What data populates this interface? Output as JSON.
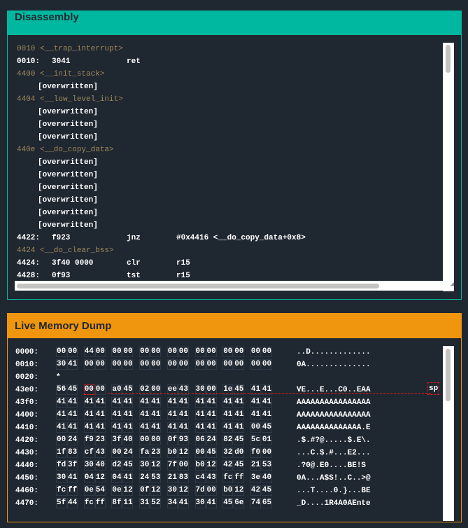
{
  "disassembly": {
    "title": "Disassembly",
    "lines": [
      {
        "kind": "label",
        "text": "0010 <__trap_interrupt>"
      },
      {
        "kind": "insn",
        "addr": "0010:",
        "bytes": "3041",
        "op": "ret",
        "args": ""
      },
      {
        "kind": "label",
        "text": "4400 <__init_stack>"
      },
      {
        "kind": "over",
        "text": "[overwritten]"
      },
      {
        "kind": "label",
        "text": "4404 <__low_level_init>"
      },
      {
        "kind": "over",
        "text": "[overwritten]"
      },
      {
        "kind": "over",
        "text": "[overwritten]"
      },
      {
        "kind": "over",
        "text": "[overwritten]"
      },
      {
        "kind": "label",
        "text": "440e <__do_copy_data>"
      },
      {
        "kind": "over",
        "text": "[overwritten]"
      },
      {
        "kind": "over",
        "text": "[overwritten]"
      },
      {
        "kind": "over",
        "text": "[overwritten]"
      },
      {
        "kind": "over",
        "text": "[overwritten]"
      },
      {
        "kind": "over",
        "text": "[overwritten]"
      },
      {
        "kind": "over",
        "text": "[overwritten]"
      },
      {
        "kind": "insn",
        "addr": "4422:",
        "bytes": "f923",
        "op": "jnz",
        "args": "#0x4416 <__do_copy_data+0x8>"
      },
      {
        "kind": "label",
        "text": "4424 <__do_clear_bss>"
      },
      {
        "kind": "insn",
        "addr": "4424:",
        "bytes": "3f40 0000",
        "op": "clr",
        "args": "r15"
      },
      {
        "kind": "insn",
        "addr": "4428:",
        "bytes": "0f93",
        "op": "tst",
        "args": "r15"
      }
    ]
  },
  "memory": {
    "title": "Live Memory Dump",
    "sp_label": "sp",
    "selected_byte": {
      "row": 3,
      "index": 2
    },
    "accent": "#e01b1b",
    "rows": [
      {
        "addr": "0000:",
        "words": [
          "0000",
          "4400",
          "0000",
          "0000",
          "0000",
          "0000",
          "0000",
          "0000"
        ],
        "ascii": "..D............."
      },
      {
        "addr": "0010:",
        "words": [
          "3041",
          "0000",
          "0000",
          "0000",
          "0000",
          "0000",
          "0000",
          "0000"
        ],
        "ascii": "0A.............."
      },
      {
        "addr": "0020:",
        "star": "*"
      },
      {
        "addr": "43e0:",
        "words": [
          "5645",
          "0000",
          "a045",
          "0200",
          "ee43",
          "3000",
          "1e45",
          "4141"
        ],
        "ascii": "VE...E...C0..EAA"
      },
      {
        "addr": "43f0:",
        "words": [
          "4141",
          "4141",
          "4141",
          "4141",
          "4141",
          "4141",
          "4141",
          "4141"
        ],
        "ascii": "AAAAAAAAAAAAAAAA"
      },
      {
        "addr": "4400:",
        "words": [
          "4141",
          "4141",
          "4141",
          "4141",
          "4141",
          "4141",
          "4141",
          "4141"
        ],
        "ascii": "AAAAAAAAAAAAAAAA"
      },
      {
        "addr": "4410:",
        "words": [
          "4141",
          "4141",
          "4141",
          "4141",
          "4141",
          "4141",
          "4141",
          "0045"
        ],
        "ascii": "AAAAAAAAAAAAAA.E"
      },
      {
        "addr": "4420:",
        "words": [
          "0024",
          "f923",
          "3f40",
          "0000",
          "0f93",
          "0624",
          "8245",
          "5c01"
        ],
        "ascii": ".$.#?@.....$.E\\."
      },
      {
        "addr": "4430:",
        "words": [
          "1f83",
          "cf43",
          "0024",
          "fa23",
          "b012",
          "0045",
          "32d0",
          "f000"
        ],
        "ascii": "...C.$.#...E2..."
      },
      {
        "addr": "4440:",
        "words": [
          "fd3f",
          "3040",
          "d245",
          "3012",
          "7f00",
          "b012",
          "4245",
          "2153"
        ],
        "ascii": ".?0@.E0....BE!S"
      },
      {
        "addr": "4450:",
        "words": [
          "3041",
          "0412",
          "0441",
          "2453",
          "2183",
          "c443",
          "fcff",
          "3e40"
        ],
        "ascii": "0A...A$S!..C..>@"
      },
      {
        "addr": "4460:",
        "words": [
          "fcff",
          "0e54",
          "0e12",
          "0f12",
          "3012",
          "7d00",
          "b012",
          "4245"
        ],
        "ascii": "...T....0.}...BE"
      },
      {
        "addr": "4470:",
        "words": [
          "5f44",
          "fcff",
          "8f11",
          "3152",
          "3441",
          "3041",
          "456e",
          "7465"
        ],
        "ascii": "_D....1R4A0AEnte"
      }
    ]
  }
}
